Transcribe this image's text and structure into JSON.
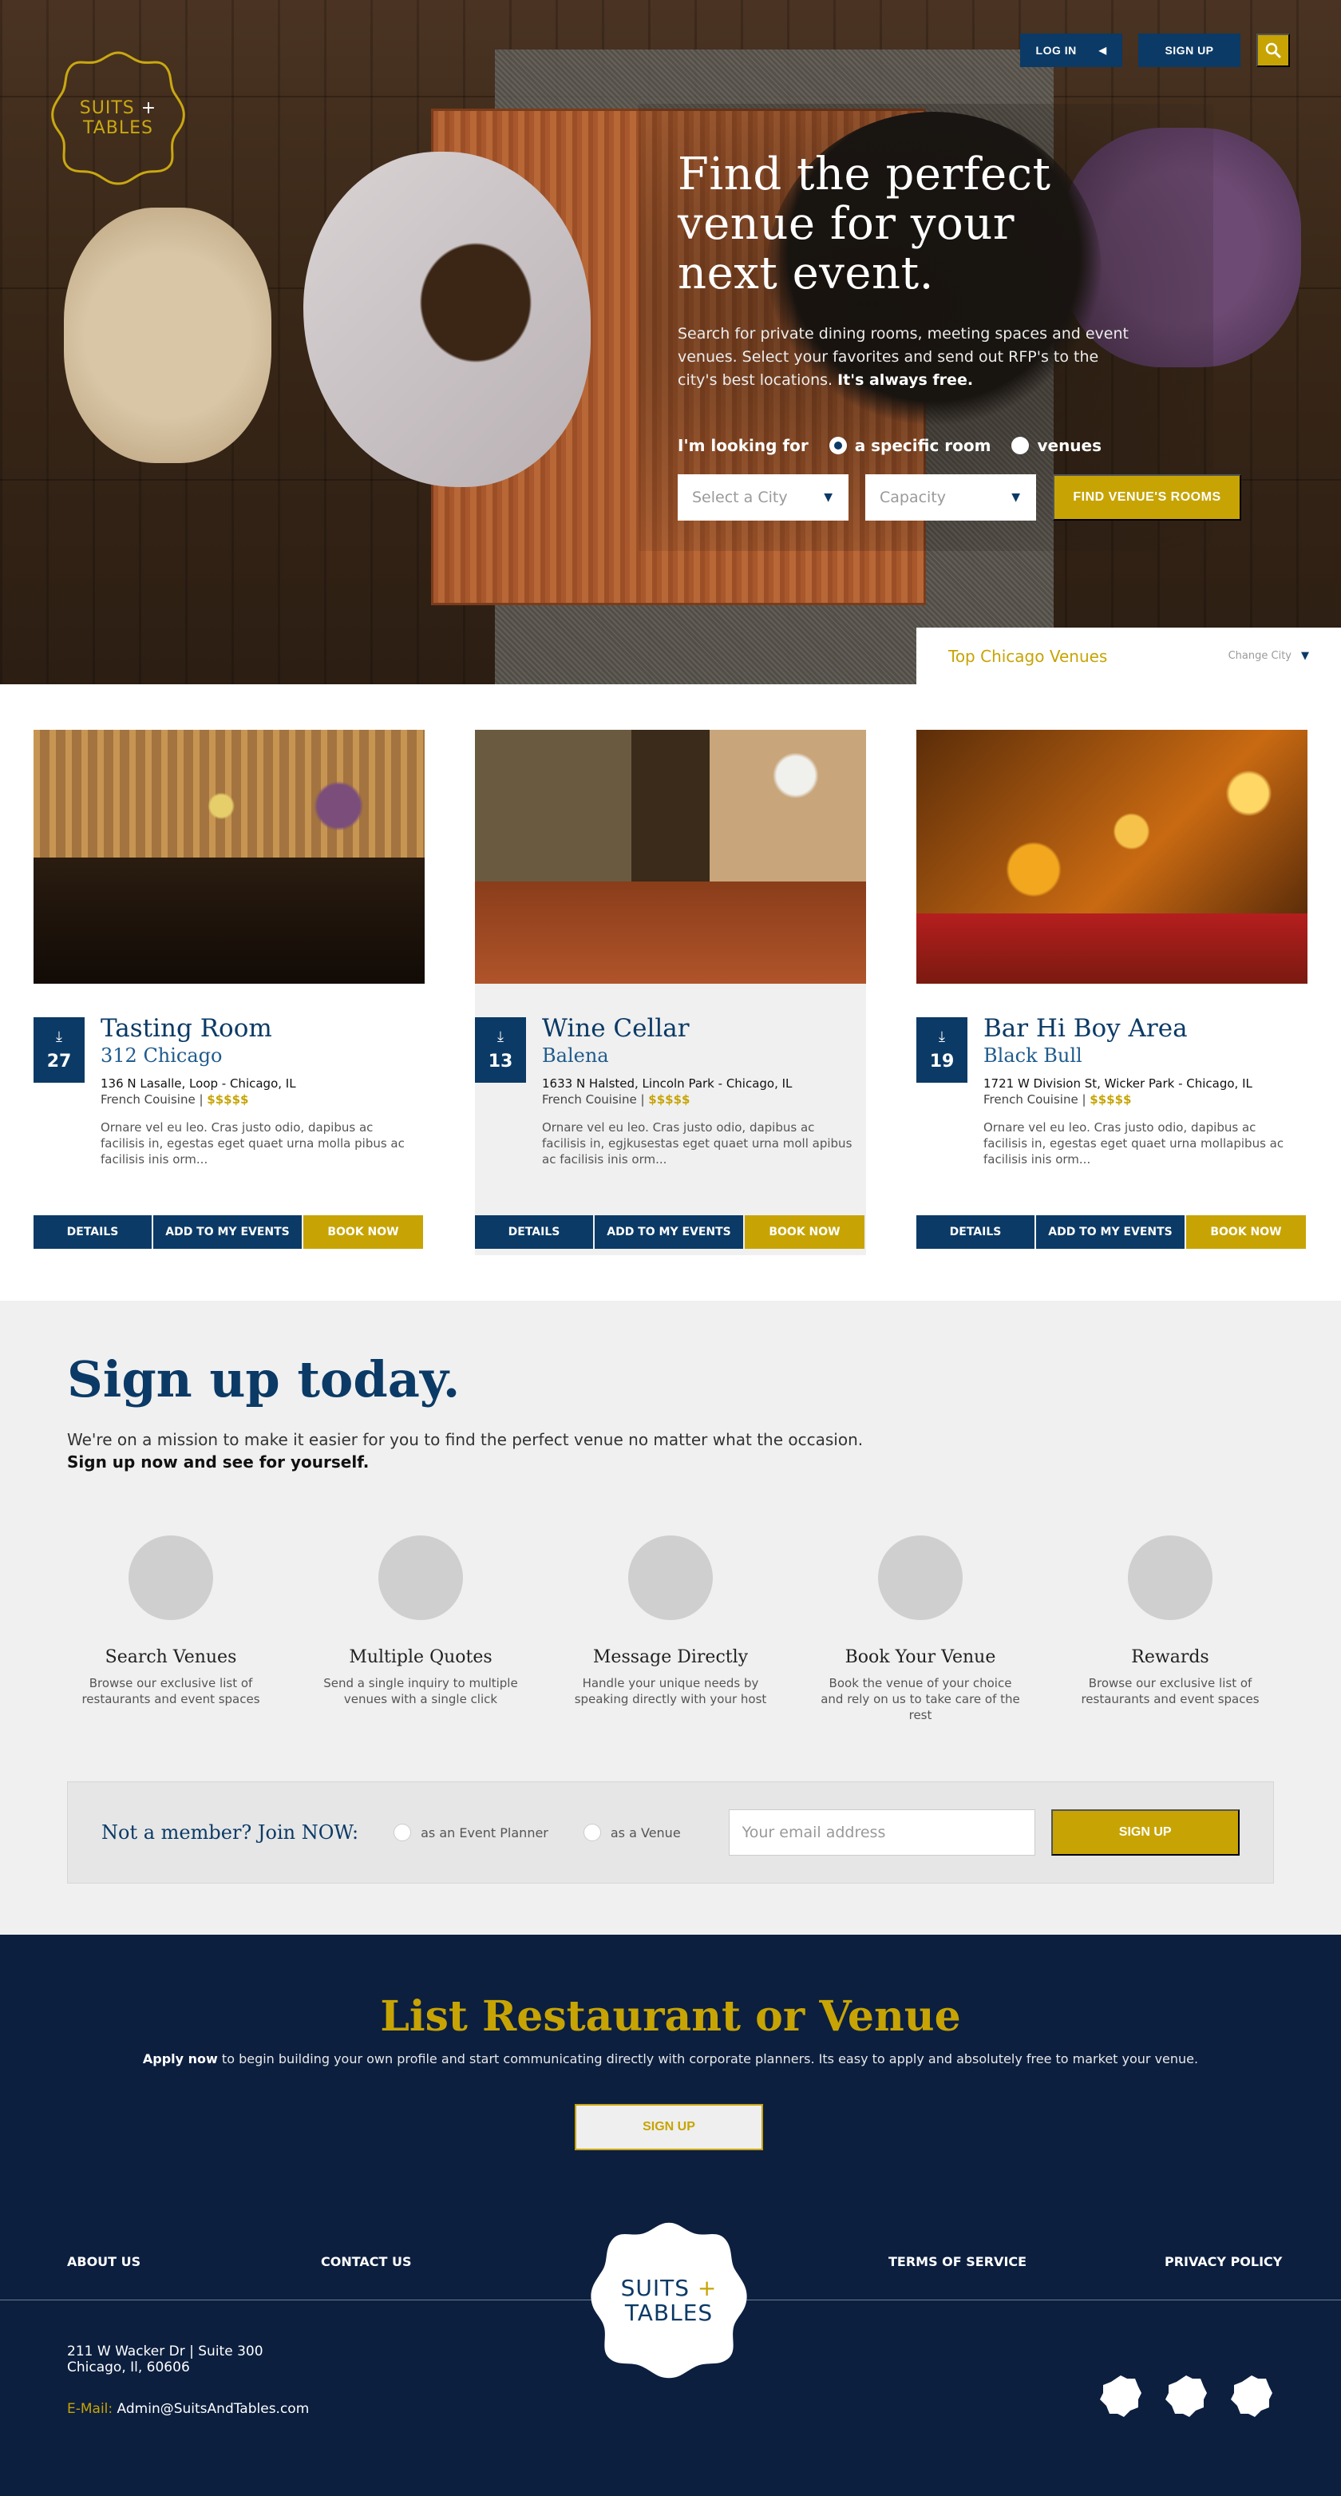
{
  "header": {
    "logo_line1": "SUITS",
    "logo_plus": "+",
    "logo_line2": "TABLES",
    "login_label": "LOG IN",
    "signup_label": "SIGN UP",
    "search_icon": "search-icon"
  },
  "hero": {
    "title_line1": "Find the perfect",
    "title_line2": "venue for your",
    "title_line3": "next event.",
    "sub_text": "Search for private dining rooms, meeting spaces and event venues. Select your favorites and send out RFP's to the city's best locations.",
    "sub_bold": "It's always free.",
    "looking_label": "I'm looking for",
    "option_room": "a specific room",
    "option_venues": "venues",
    "city_placeholder": "Select a City",
    "capacity_placeholder": "Capacity",
    "find_button": "FIND VENUE'S ROOMS"
  },
  "top_venues": {
    "title": "Top Chicago Venues",
    "change_city": "Change City"
  },
  "cards": [
    {
      "date": "27",
      "title": "Tasting Room",
      "subtitle": "312 Chicago",
      "address": "136 N Lasalle, Loop - Chicago, IL",
      "cuisine": "French Couisine |",
      "price": "$$$$$",
      "desc": "Ornare vel eu leo. Cras justo odio, dapibus ac facilisis in, egestas eget quaet urna molla pibus ac facilisis inis orm...",
      "details": "DETAILS",
      "add": "ADD TO MY EVENTS",
      "book": "BOOK NOW"
    },
    {
      "date": "13",
      "title": "Wine Cellar",
      "subtitle": "Balena",
      "address": "1633 N Halsted, Lincoln Park - Chicago, IL",
      "cuisine": "French Couisine |",
      "price": "$$$$$",
      "desc": "Ornare vel eu leo. Cras justo odio, dapibus ac facilisis in, egjkusestas eget quaet urna moll apibus ac facilisis inis orm...",
      "details": "DETAILS",
      "add": "ADD TO MY EVENTS",
      "book": "BOOK NOW"
    },
    {
      "date": "19",
      "title": "Bar Hi Boy Area",
      "subtitle": "Black Bull",
      "address": "1721 W Division St, Wicker Park - Chicago, IL",
      "cuisine": "French Couisine |",
      "price": "$$$$$",
      "desc": "Ornare vel eu leo. Cras justo odio, dapibus ac facilisis in, egestas eget quaet urna mollapibus ac facilisis inis orm...",
      "details": "DETAILS",
      "add": "ADD TO MY EVENTS",
      "book": "BOOK NOW"
    }
  ],
  "signup": {
    "title": "Sign up today.",
    "lead": "We're on a mission to make it easier for you to find the perfect venue no matter what the occasion.",
    "lead_bold": "Sign up now and see for yourself.",
    "features": [
      {
        "title": "Search Venues",
        "desc": "Browse our exclusive list of restaurants and event spaces"
      },
      {
        "title": "Multiple Quotes",
        "desc": "Send a single inquiry to multiple venues with a single click"
      },
      {
        "title": "Message Directly",
        "desc": "Handle your unique needs by speaking directly with your host"
      },
      {
        "title": "Book Your Venue",
        "desc": "Book the venue of your choice and rely on us to take care of the rest"
      },
      {
        "title": "Rewards",
        "desc": "Browse our exclusive list of restaurants and event spaces"
      }
    ],
    "join_title": "Not a member? Join NOW:",
    "join_planner": "as an Event Planner",
    "join_venue": "as a Venue",
    "email_placeholder": "Your email address",
    "join_button": "SIGN UP"
  },
  "list_venue": {
    "title": "List Restaurant or Venue",
    "sub_bold": "Apply now",
    "sub_text": "to begin building your own profile and start communicating directly with corporate planners. Its easy to apply and absolutely free to market your venue.",
    "button": "SIGN UP"
  },
  "footer": {
    "about": "ABOUT US",
    "contact": "CONTACT US",
    "terms": "TERMS OF SERVICE",
    "privacy": "PRIVACY POLICY",
    "logo_line1": "SUITS",
    "logo_plus": "+",
    "logo_line2": "TABLES",
    "address_line1": "211 W Wacker Dr | Suite 300",
    "address_line2": "Chicago, Il, 60606",
    "email_label": "E-Mail:",
    "email_value": "Admin@SuitsAndTables.com"
  },
  "colors": {
    "navy": "#0b3a66",
    "gold": "#c7a404",
    "footer_bg": "#0c1f3f",
    "section_grey": "#f0f0f0"
  }
}
